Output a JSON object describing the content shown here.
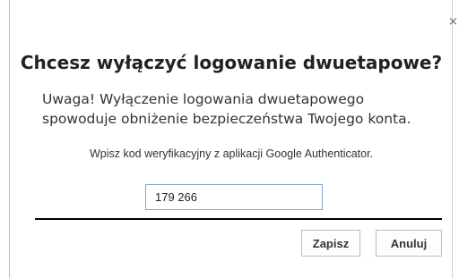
{
  "dialog": {
    "close_glyph": "×",
    "title": "Chcesz wyłączyć logowanie dwuetapowe?",
    "warning": "Uwaga! Wyłączenie logowania dwuetapowego spowoduje obniżenie bezpieczeństwa Twojego konta.",
    "instruction": "Wpisz kod weryfikacyjny z aplikacji Google Authenticator.",
    "code_value": "179 266",
    "save_label": "Zapisz",
    "cancel_label": "Anuluj"
  }
}
